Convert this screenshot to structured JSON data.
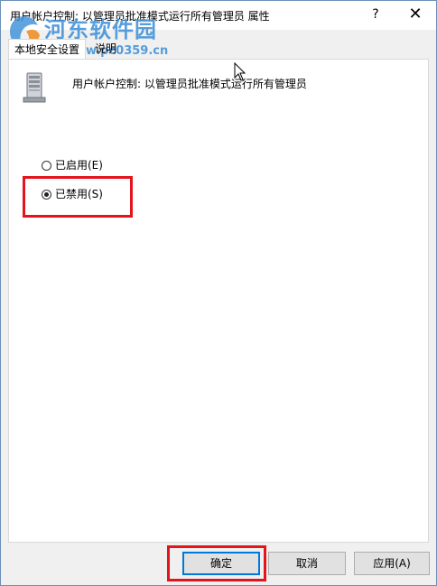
{
  "window": {
    "title": "用户帐户控制: 以管理员批准模式运行所有管理员 属性",
    "help_symbol": "?",
    "close_symbol": "✕"
  },
  "watermark": {
    "name": "河东软件园",
    "url": "www.pc0359.cn"
  },
  "tabs": [
    {
      "label": "本地安全设置",
      "active": true
    },
    {
      "label": "说明",
      "active": false
    }
  ],
  "policy": {
    "name": "用户帐户控制: 以管理员批准模式运行所有管理员",
    "icon": "server-icon"
  },
  "options": {
    "enabled_label": "已启用(E)",
    "disabled_label": "已禁用(S)",
    "selected": "disabled"
  },
  "buttons": {
    "ok_label": "确定",
    "cancel_label": "取消",
    "apply_label": "应用(A)"
  },
  "colors": {
    "highlight": "#e3141c",
    "focus": "#0078d7",
    "watermark": "#3a8ed8"
  }
}
